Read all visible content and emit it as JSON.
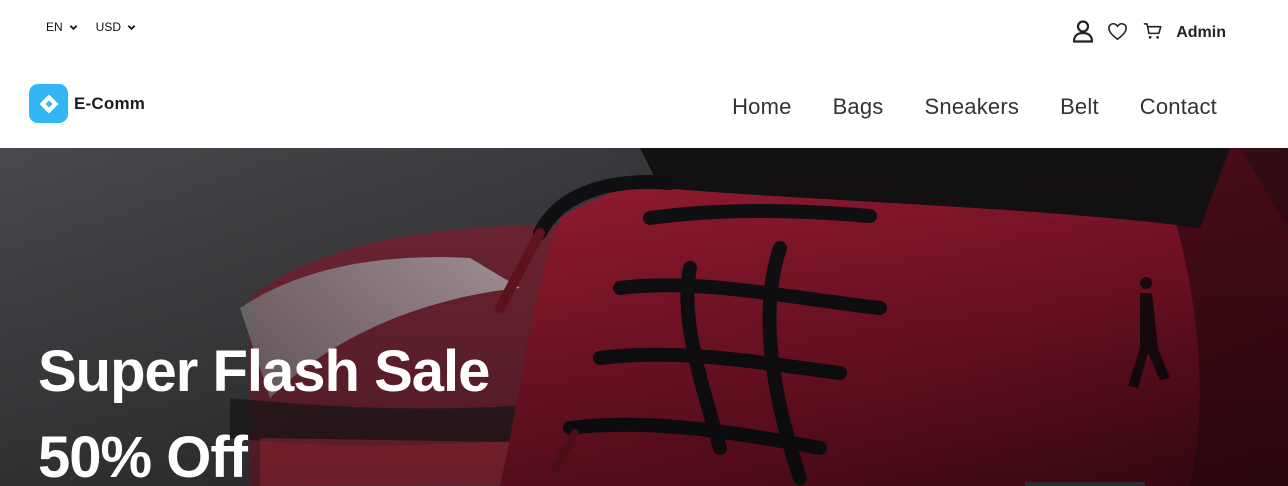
{
  "topbar": {
    "language": "EN",
    "currency": "USD",
    "account_label": "Admin"
  },
  "brand": {
    "name": "E-Comm",
    "accent_color": "#33b6f5"
  },
  "nav": {
    "items": [
      {
        "label": "Home"
      },
      {
        "label": "Bags"
      },
      {
        "label": "Sneakers"
      },
      {
        "label": "Belt"
      },
      {
        "label": "Contact"
      }
    ]
  },
  "hero": {
    "title": "Super Flash Sale",
    "subtitle": "50% Off",
    "image": "red-sneaker-closeup"
  },
  "icons": [
    "chevron-down-icon",
    "user-icon",
    "heart-icon",
    "cart-icon",
    "logo-icon"
  ]
}
